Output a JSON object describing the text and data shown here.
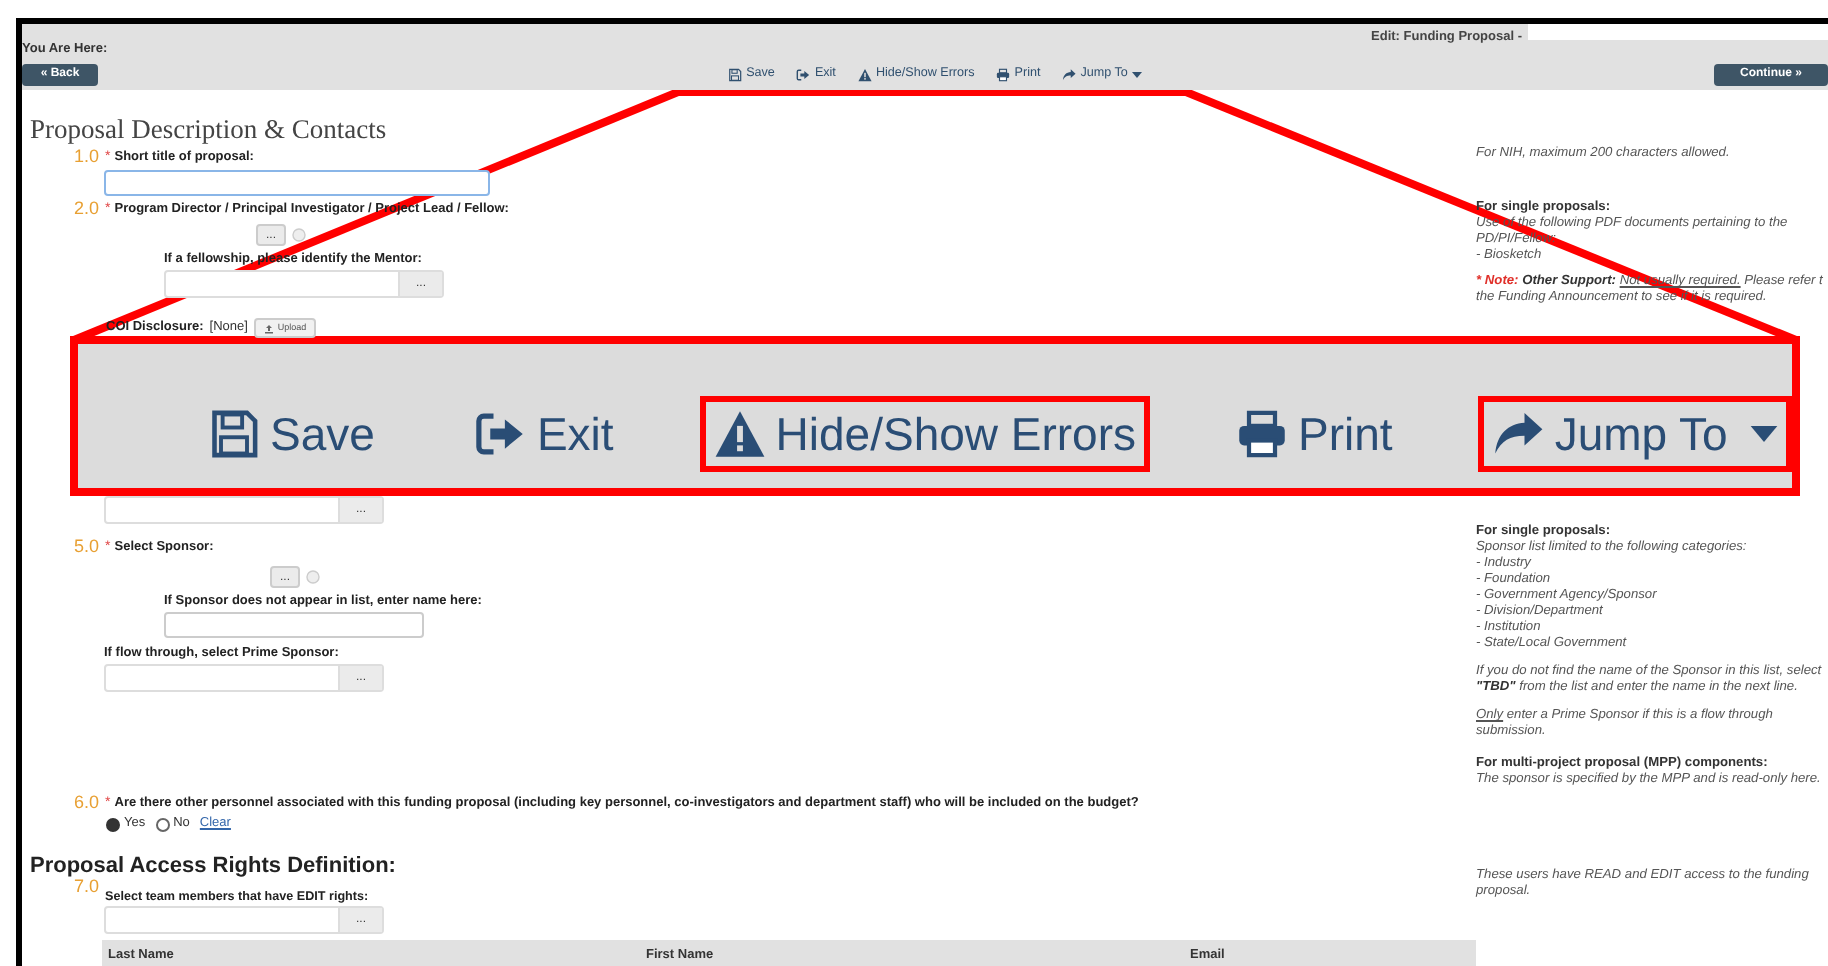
{
  "header": {
    "breadcrumb_label": "You Are Here:",
    "edit_title": "Edit: Funding Proposal -",
    "back": "« Back",
    "continue": "Continue »"
  },
  "toolbar": [
    {
      "kind": "save",
      "label": "Save"
    },
    {
      "kind": "exit",
      "label": "Exit"
    },
    {
      "kind": "errors",
      "label": "Hide/Show Errors"
    },
    {
      "kind": "print",
      "label": "Print"
    },
    {
      "kind": "jump",
      "label": "Jump To"
    }
  ],
  "callout": {
    "items": [
      {
        "kind": "save",
        "label": "Save",
        "highlighted": false
      },
      {
        "kind": "exit",
        "label": "Exit",
        "highlighted": false
      },
      {
        "kind": "errors",
        "label": "Hide/Show Errors",
        "highlighted": true
      },
      {
        "kind": "print",
        "label": "Print",
        "highlighted": false
      },
      {
        "kind": "jump",
        "label": "Jump To",
        "highlighted": true
      }
    ]
  },
  "page_title": "Proposal Description & Contacts",
  "form": [
    {
      "kind": "question",
      "number": "1.0",
      "required_mark": "*",
      "label": "Short title of proposal:"
    },
    {
      "kind": "text-field",
      "focused": true
    },
    {
      "kind": "question",
      "number": "2.0",
      "required_mark": "*",
      "label": "Program Director / Principal Investigator / Project Lead / Fellow:"
    },
    {
      "kind": "lookup-button",
      "button": "...",
      "clearable": true
    },
    {
      "kind": "sub-label",
      "label": "If a fellowship, please identify the Mentor:"
    },
    {
      "kind": "sub-lookup-field",
      "button": "..."
    },
    {
      "kind": "attachment",
      "label": "COI Disclosure:",
      "value": "[None]",
      "button": "Upload"
    },
    {
      "kind": "lookup-field",
      "button": "..."
    },
    {
      "kind": "question",
      "number": "5.0",
      "required_mark": "*",
      "label": "Select Sponsor:"
    },
    {
      "kind": "lookup-button",
      "button": "...",
      "clearable": true
    },
    {
      "kind": "sub-label",
      "label": "If Sponsor does not appear in list, enter name here:"
    },
    {
      "kind": "sub-text-field",
      "focused": false
    },
    {
      "kind": "field-label",
      "label": "If flow through, select Prime Sponsor:"
    },
    {
      "kind": "lookup-field",
      "button": "..."
    },
    {
      "kind": "question",
      "number": "6.0",
      "required_mark": "*",
      "label": "Are there other personnel associated with this funding proposal (including key personnel, co-investigators and department staff) who will be included on the budget?"
    },
    {
      "kind": "radios",
      "options": [
        {
          "label": "Yes",
          "selected": true
        },
        {
          "label": "No",
          "selected": false
        }
      ],
      "clear": "Clear"
    },
    {
      "kind": "section",
      "label": "Proposal Access Rights Definition:"
    },
    {
      "kind": "question",
      "number": "7.0",
      "label": "Select team members that have EDIT rights:"
    },
    {
      "kind": "lookup-field",
      "button": "..."
    },
    {
      "kind": "table",
      "columns": [
        "Last Name",
        "First Name",
        "Email"
      ]
    }
  ],
  "help": [
    [
      [
        {
          "kind": "italic",
          "text": "For NIH, maximum 200 characters allowed."
        }
      ]
    ],
    [
      [
        {
          "kind": "heading",
          "text": "For single proposals:"
        }
      ],
      [
        {
          "kind": "italic",
          "text": "Use of the following PDF documents pertaining to the"
        }
      ],
      [
        {
          "kind": "italic",
          "text": "PD/PI/Fellow:"
        }
      ],
      [
        {
          "kind": "italic",
          "text": "- Biosketch"
        }
      ]
    ],
    [
      [
        {
          "kind": "note",
          "text": "* Note:"
        },
        {
          "kind": "emph",
          "text": " Other Support: "
        },
        {
          "kind": "underline",
          "text": "Not usually required."
        },
        {
          "kind": "italic",
          "text": "  Please refer t"
        }
      ],
      [
        {
          "kind": "italic",
          "text": "the Funding Announcement to see if it is required."
        }
      ]
    ],
    [
      [
        {
          "kind": "heading",
          "text": "For single proposals:"
        }
      ],
      [
        {
          "kind": "italic",
          "text": "Sponsor list limited to the following categories:"
        }
      ],
      [
        {
          "kind": "italic",
          "text": "- Industry"
        }
      ],
      [
        {
          "kind": "italic",
          "text": "- Foundation"
        }
      ],
      [
        {
          "kind": "italic",
          "text": "- Government Agency/Sponsor"
        }
      ],
      [
        {
          "kind": "italic",
          "text": "- Division/Department"
        }
      ],
      [
        {
          "kind": "italic",
          "text": "- Institution"
        }
      ],
      [
        {
          "kind": "italic",
          "text": "- State/Local Government"
        }
      ]
    ],
    [
      [
        {
          "kind": "italic",
          "text": "If you do not find the name of the Sponsor in this list, select"
        }
      ],
      [
        {
          "kind": "emph",
          "text": "\"TBD\""
        },
        {
          "kind": "italic",
          "text": " from the list and enter the name in the next line."
        }
      ]
    ],
    [
      [
        {
          "kind": "underline",
          "text": "Only"
        },
        {
          "kind": "italic",
          "text": " enter a Prime Sponsor if this is a flow through"
        }
      ],
      [
        {
          "kind": "italic",
          "text": "submission."
        }
      ]
    ],
    [
      [
        {
          "kind": "heading",
          "text": "For multi-project proposal (MPP) components:"
        }
      ],
      [
        {
          "kind": "italic",
          "text": "The sponsor is specified by the MPP and is read-only here."
        }
      ]
    ],
    [
      [
        {
          "kind": "italic",
          "text": "These users have READ and EDIT access to the funding"
        }
      ],
      [
        {
          "kind": "italic",
          "text": "proposal."
        }
      ]
    ]
  ]
}
